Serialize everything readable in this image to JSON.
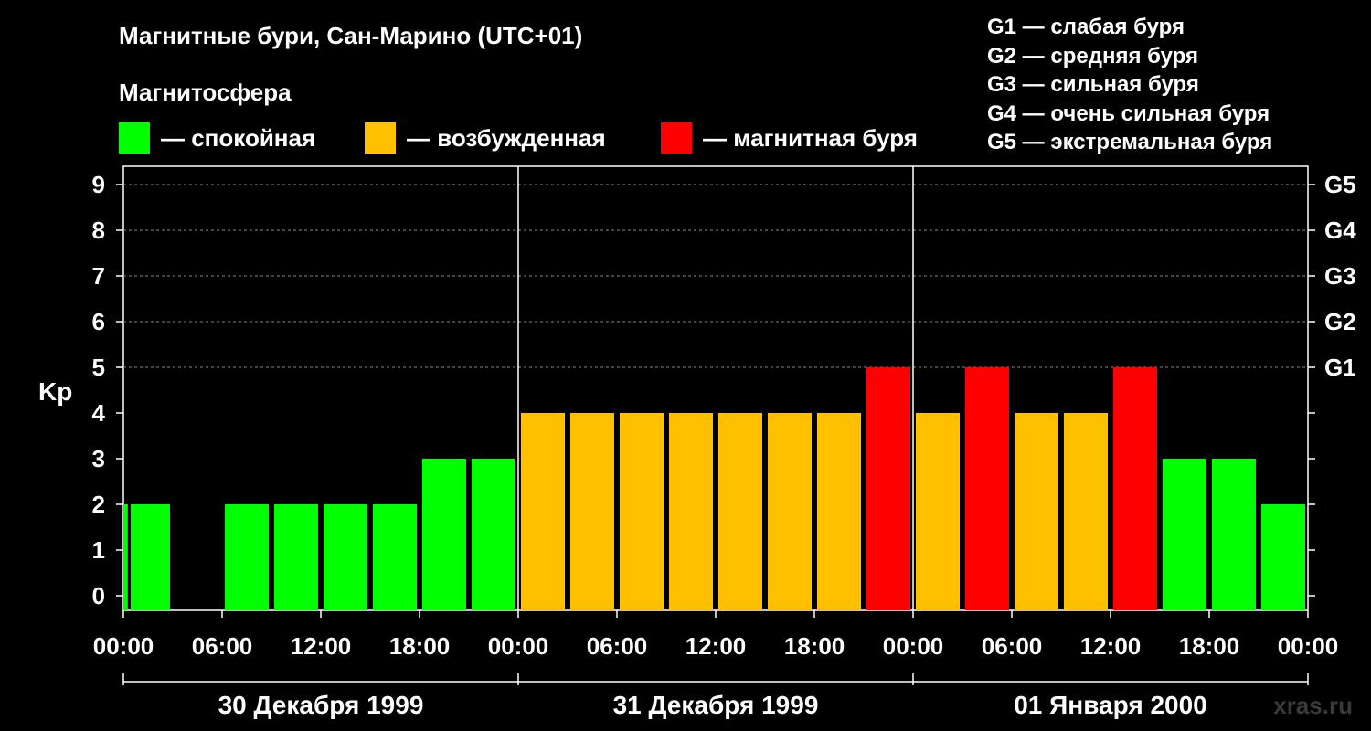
{
  "title": "Магнитные бури, Сан-Марино (UTC+01)",
  "subtitle": "Магнитосфера",
  "legend": [
    {
      "label": "— спокойная",
      "color": "#00ff00"
    },
    {
      "label": "— возбужденная",
      "color": "#ffc000"
    },
    {
      "label": "— магнитная буря",
      "color": "#ff0000"
    }
  ],
  "g_legend": [
    "G1 — слабая буря",
    "G2 — средняя буря",
    "G3 — сильная буря",
    "G4 — очень сильная буря",
    "G5 — экстремальная буря"
  ],
  "watermark": "xras.ru",
  "chart_data": {
    "type": "bar",
    "ylabel": "Kp",
    "ylim": [
      0,
      9
    ],
    "yticks": [
      "0",
      "1",
      "2",
      "3",
      "4",
      "5",
      "6",
      "7",
      "8",
      "9"
    ],
    "right_ticks": [
      {
        "value": 5,
        "label": "G1"
      },
      {
        "value": 6,
        "label": "G2"
      },
      {
        "value": 7,
        "label": "G3"
      },
      {
        "value": 8,
        "label": "G4"
      },
      {
        "value": 9,
        "label": "G5"
      }
    ],
    "x_tick_labels": [
      "00:00",
      "06:00",
      "12:00",
      "18:00",
      "00:00",
      "06:00",
      "12:00",
      "18:00",
      "00:00",
      "06:00",
      "12:00",
      "18:00",
      "00:00"
    ],
    "day_labels": [
      "30 Декабря 1999",
      "31 Декабря 1999",
      "01 Января 2000"
    ],
    "bar_interval_hours": 3,
    "time_range_hours": [
      0,
      72
    ],
    "bars": [
      {
        "start": "30 Декабря 1999 00:00",
        "value": 2,
        "level": "спокойная"
      },
      {
        "start": "30 Декабря 1999 00:00",
        "value": 2,
        "level": "спокойная"
      },
      {
        "start": "30 Декабря 1999 03:00",
        "value": 0,
        "level": "спокойная"
      },
      {
        "start": "30 Декабря 1999 06:00",
        "value": 2,
        "level": "спокойная"
      },
      {
        "start": "30 Декабря 1999 09:00",
        "value": 2,
        "level": "спокойная"
      },
      {
        "start": "30 Декабря 1999 12:00",
        "value": 2,
        "level": "спокойная"
      },
      {
        "start": "30 Декабря 1999 15:00",
        "value": 2,
        "level": "спокойная"
      },
      {
        "start": "30 Декабря 1999 18:00",
        "value": 3,
        "level": "спокойная"
      },
      {
        "start": "30 Декабря 1999 21:00",
        "value": 3,
        "level": "спокойная"
      },
      {
        "start": "31 Декабря 1999 00:00",
        "value": 4,
        "level": "возбужденная"
      },
      {
        "start": "31 Декабря 1999 03:00",
        "value": 4,
        "level": "возбужденная"
      },
      {
        "start": "31 Декабря 1999 06:00",
        "value": 4,
        "level": "возбужденная"
      },
      {
        "start": "31 Декабря 1999 09:00",
        "value": 4,
        "level": "возбужденная"
      },
      {
        "start": "31 Декабря 1999 12:00",
        "value": 4,
        "level": "возбужденная"
      },
      {
        "start": "31 Декабря 1999 15:00",
        "value": 4,
        "level": "возбужденная"
      },
      {
        "start": "31 Декабря 1999 18:00",
        "value": 4,
        "level": "возбужденная"
      },
      {
        "start": "31 Декабря 1999 21:00",
        "value": 5,
        "level": "магнитная буря"
      },
      {
        "start": "01 Января 2000 00:00",
        "value": 4,
        "level": "возбужденная"
      },
      {
        "start": "01 Января 2000 03:00",
        "value": 5,
        "level": "магнитная буря"
      },
      {
        "start": "01 Января 2000 06:00",
        "value": 4,
        "level": "возбужденная"
      },
      {
        "start": "01 Января 2000 09:00",
        "value": 4,
        "level": "возбужденная"
      },
      {
        "start": "01 Января 2000 12:00",
        "value": 5,
        "level": "магнитная буря"
      },
      {
        "start": "01 Января 2000 15:00",
        "value": 3,
        "level": "спокойная"
      },
      {
        "start": "01 Января 2000 18:00",
        "value": 3,
        "level": "спокойная"
      },
      {
        "start": "01 Января 2000 21:00",
        "value": 2,
        "level": "спокойная"
      }
    ],
    "grid": "horizontal dashed",
    "colors": {
      "спокойная": "#00ff00",
      "возбужденная": "#ffc000",
      "магнитная буря": "#ff0000"
    }
  }
}
